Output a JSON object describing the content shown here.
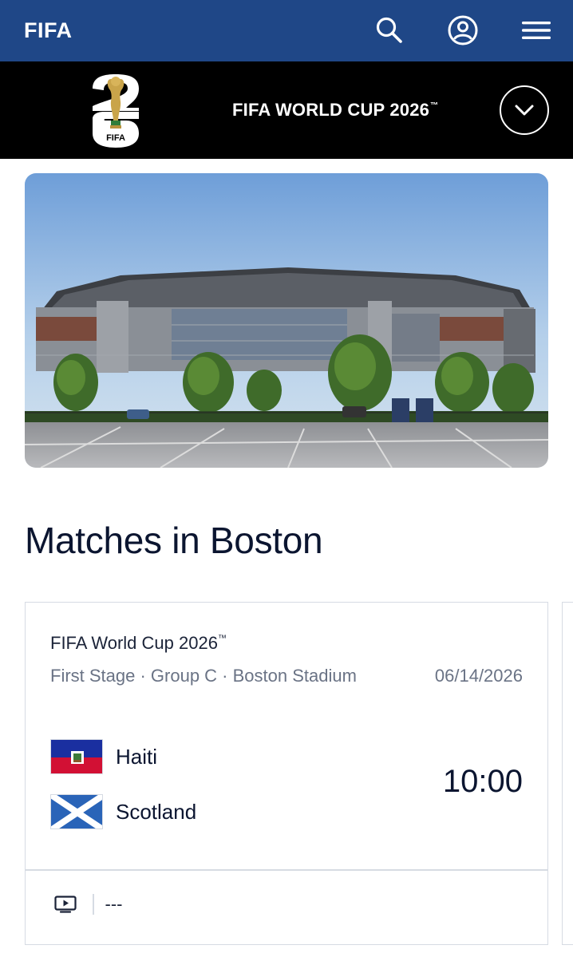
{
  "topbar": {
    "logo_text": "FIFA",
    "icons": {
      "search": "search-icon",
      "account": "account-icon",
      "menu": "hamburger-menu-icon"
    },
    "background": "#1f4787"
  },
  "tournament_bar": {
    "emblem_text": "FIFA",
    "title": "FIFA WORLD CUP 2026",
    "trademark": "™",
    "toggle_icon": "chevron-down-icon"
  },
  "hero": {
    "image": "stadium-photo"
  },
  "section": {
    "title": "Matches in Boston"
  },
  "match": {
    "competition": "FIFA World Cup 2026",
    "competition_mark": "™",
    "stage": "First Stage · Group C · Boston Stadium",
    "date": "06/14/2026",
    "home_team": "Haiti",
    "away_team": "Scotland",
    "kickoff": "10:00",
    "broadcast_icon": "tv-icon",
    "broadcast": "---"
  }
}
